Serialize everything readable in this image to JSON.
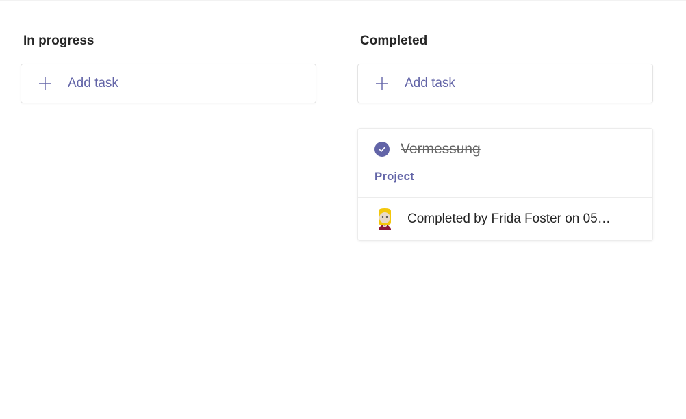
{
  "columns": {
    "in_progress": {
      "title": "In progress",
      "add_label": "Add task"
    },
    "completed": {
      "title": "Completed",
      "add_label": "Add task"
    }
  },
  "tasks": {
    "completed_task": {
      "title": "Vermessung",
      "project_label": "Project",
      "completed_text": "Completed by Frida Foster on 05…"
    }
  }
}
